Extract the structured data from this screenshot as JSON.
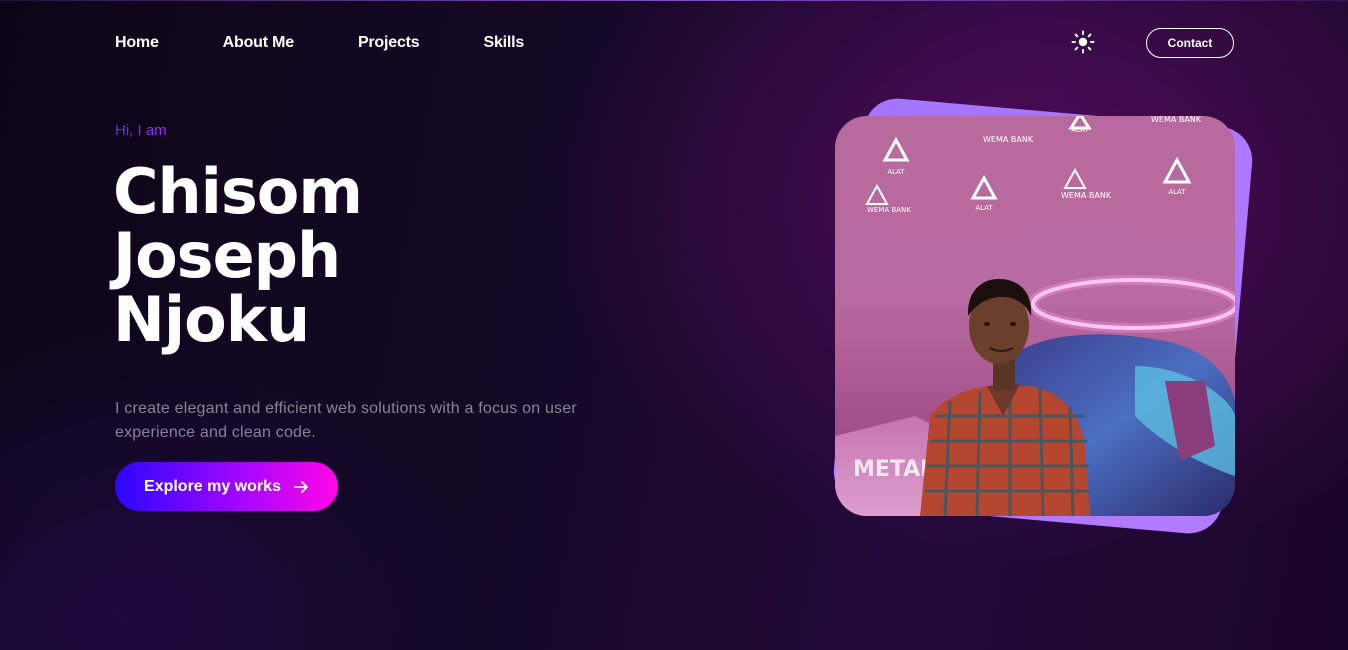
{
  "nav": {
    "items": [
      {
        "label": "Home"
      },
      {
        "label": "About Me"
      },
      {
        "label": "Projects"
      },
      {
        "label": "Skills"
      }
    ],
    "contact_label": "Contact",
    "theme_icon": "sun-icon"
  },
  "hero": {
    "greeting": "Hi, I am",
    "name_lines": [
      "Chisom",
      "Joseph",
      "Njoku"
    ],
    "description": "I create elegant and efficient web solutions with a focus on user experience and clean code.",
    "cta_label": "Explore my works",
    "cta_icon": "arrow-right-icon"
  },
  "photo": {
    "backdrop_logos": [
      "ALAT",
      "WEMA BANK",
      "ALAT",
      "WEMA BANK",
      "WEMA BANK",
      "ALAT",
      "WEMA BANK",
      "ALAT"
    ],
    "backdrop_text": "METAI"
  },
  "colors": {
    "accent_start": "#2b07ff",
    "accent_mid": "#a106ff",
    "accent_end": "#ff06e6",
    "frame": "#a475ff",
    "text_muted": "#8a8296"
  }
}
